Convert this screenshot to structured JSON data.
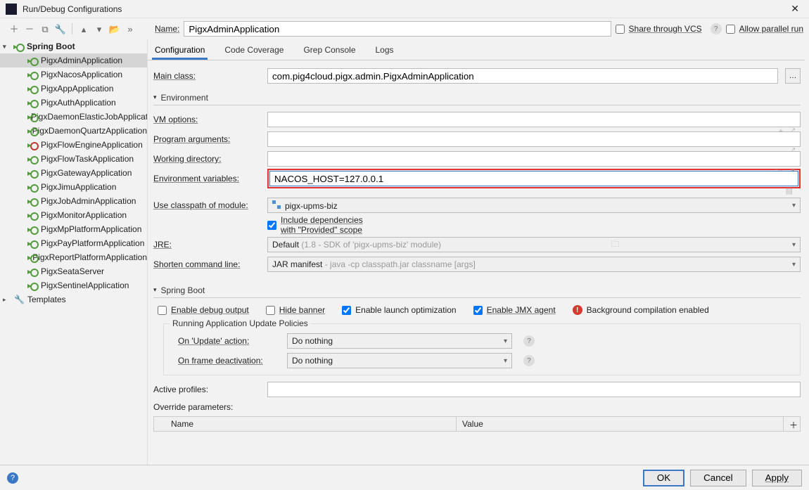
{
  "window": {
    "title": "Run/Debug Configurations"
  },
  "nameRow": {
    "label": "Name:",
    "value": "PigxAdminApplication",
    "share": "Share through VCS",
    "allowParallel": "Allow parallel run"
  },
  "tree": {
    "group": "Spring Boot",
    "templates": "Templates",
    "items": [
      "PigxAdminApplication",
      "PigxNacosApplication",
      "PigxAppApplication",
      "PigxAuthApplication",
      "PigxDaemonElasticJobApplication",
      "PigxDaemonQuartzApplication",
      "PigxFlowEngineApplication",
      "PigxFlowTaskApplication",
      "PigxGatewayApplication",
      "PigxJimuApplication",
      "PigxJobAdminApplication",
      "PigxMonitorApplication",
      "PigxMpPlatformApplication",
      "PigxPayPlatformApplication",
      "PigxReportPlatformApplication",
      "PigxSeataServer",
      "PigxSentinelApplication"
    ],
    "errorIndex": 6
  },
  "tabs": [
    "Configuration",
    "Code Coverage",
    "Grep Console",
    "Logs"
  ],
  "form": {
    "mainClassLabel": "Main class:",
    "mainClass": "com.pig4cloud.pigx.admin.PigxAdminApplication",
    "envHdr": "Environment",
    "vmLabel": "VM options:",
    "argsLabel": "Program arguments:",
    "wdLabel": "Working directory:",
    "envLabel": "Environment variables:",
    "envValue": "NACOS_HOST=127.0.0.1",
    "moduleLabel": "Use classpath of module:",
    "moduleValue": "pigx-upms-biz",
    "includeProvided": "Include dependencies with \"Provided\" scope",
    "jreLabel": "JRE:",
    "jreValue": "Default",
    "jreHint": "(1.8 - SDK of 'pigx-upms-biz' module)",
    "shortenLabel": "Shorten command line:",
    "shortenValue": "JAR manifest",
    "shortenHint": "- java -cp classpath.jar classname [args]",
    "sbHdr": "Spring Boot",
    "enableDebug": "Enable debug output",
    "hideBanner": "Hide banner",
    "enableLaunch": "Enable launch optimization",
    "enableJmx": "Enable JMX agent",
    "bgCompile": "Background compilation enabled",
    "policiesHdr": "Running Application Update Policies",
    "onUpdateLabel": "On 'Update' action:",
    "onUpdateValue": "Do nothing",
    "onFrameLabel": "On frame deactivation:",
    "onFrameValue": "Do nothing",
    "activeProfilesLabel": "Active profiles:",
    "overrideLabel": "Override parameters:",
    "colName": "Name",
    "colValue": "Value"
  },
  "footer": {
    "ok": "OK",
    "cancel": "Cancel",
    "apply": "Apply"
  }
}
